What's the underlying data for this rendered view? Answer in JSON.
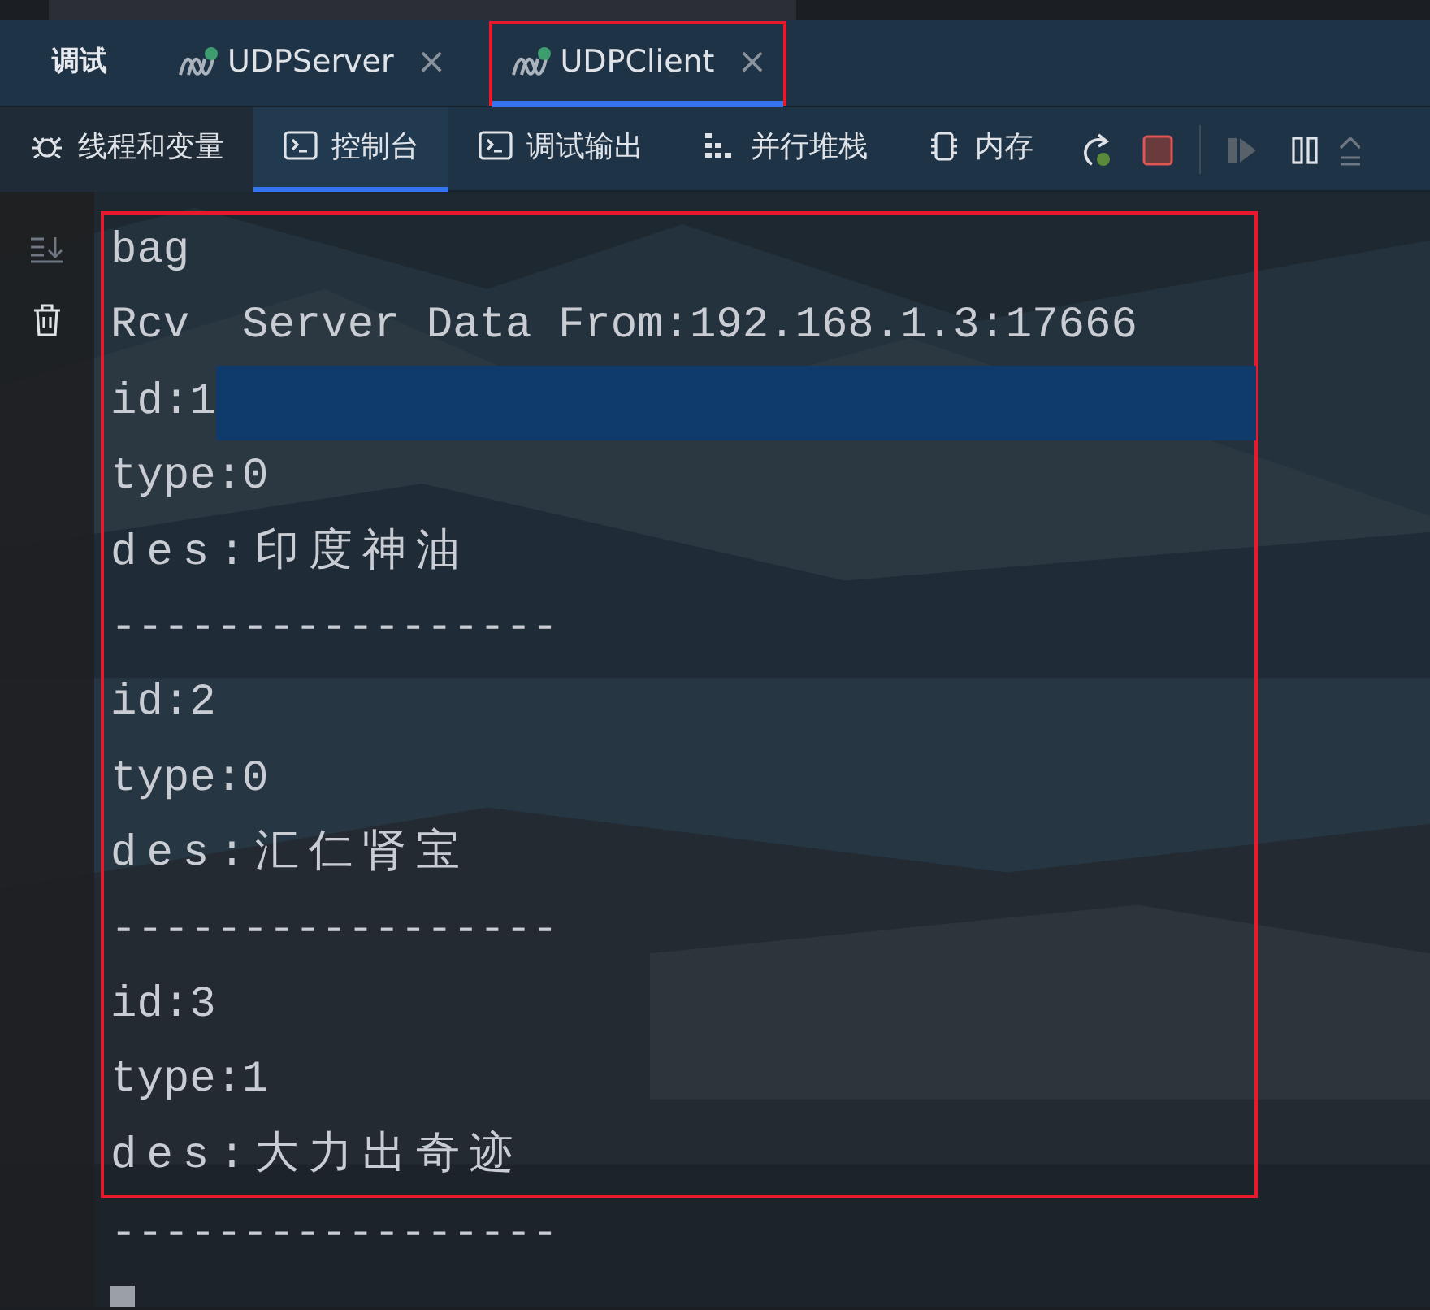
{
  "tool_window": {
    "title": "调试"
  },
  "sessions": [
    {
      "label": "UDPServer",
      "selected": false,
      "framed": false,
      "close": "×"
    },
    {
      "label": "UDPClient",
      "selected": true,
      "framed": true,
      "close": "×"
    }
  ],
  "views": [
    {
      "label": "线程和变量",
      "kind": "bug",
      "selected": false
    },
    {
      "label": "控制台",
      "kind": "terminal",
      "selected": true
    },
    {
      "label": "调试输出",
      "kind": "terminal",
      "selected": false
    },
    {
      "label": "并行堆栈",
      "kind": "stacks",
      "selected": false
    },
    {
      "label": "内存",
      "kind": "chip",
      "selected": false
    }
  ],
  "actions": [
    {
      "kind": "rerun",
      "disabled": false
    },
    {
      "kind": "stop",
      "disabled": false
    },
    {
      "kind": "resume",
      "disabled": true
    },
    {
      "kind": "pause",
      "disabled": false
    }
  ],
  "console": {
    "framed_lines": [
      {
        "text": "bag",
        "selected": false
      },
      {
        "text": "Rcv  Server Data From:192.168.1.3:17666",
        "selected": false
      },
      {
        "text": "id:1",
        "selected": true
      },
      {
        "text": "type:0",
        "selected": false
      },
      {
        "text": "des:印度神油",
        "selected": false
      },
      {
        "text": "-----------------",
        "selected": false
      },
      {
        "text": "id:2",
        "selected": false
      },
      {
        "text": "type:0",
        "selected": false
      },
      {
        "text": "des:汇仁肾宝",
        "selected": false
      },
      {
        "text": "-----------------",
        "selected": false
      },
      {
        "text": "id:3",
        "selected": false
      },
      {
        "text": "type:1",
        "selected": false
      },
      {
        "text": "des:大力出奇迹",
        "selected": false
      }
    ],
    "lines": [
      {
        "text": "-----------------",
        "selected": false
      }
    ]
  }
}
